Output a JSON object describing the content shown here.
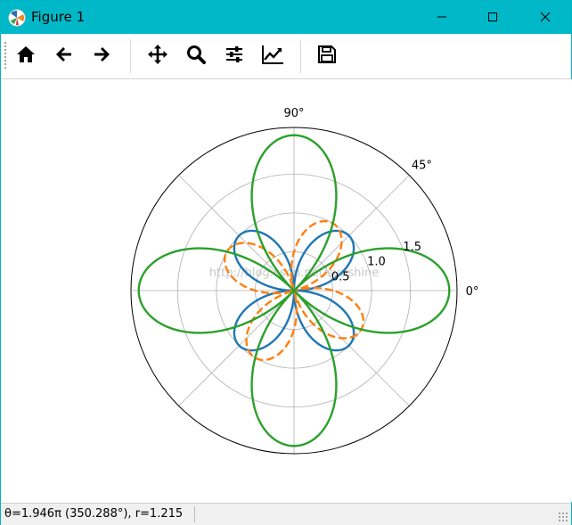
{
  "window": {
    "title": "Figure 1",
    "app_icon": "matplotlib-icon",
    "controls": [
      "minimize-icon",
      "maximize-icon",
      "close-icon"
    ]
  },
  "toolbar": {
    "buttons": [
      {
        "name": "home",
        "icon": "home-icon"
      },
      {
        "name": "back",
        "icon": "back-arrow-icon"
      },
      {
        "name": "forward",
        "icon": "forward-arrow-icon"
      },
      {
        "name": "pan",
        "icon": "move-icon"
      },
      {
        "name": "zoom",
        "icon": "zoom-icon"
      },
      {
        "name": "subplots",
        "icon": "sliders-icon"
      },
      {
        "name": "customize",
        "icon": "line-chart-icon"
      },
      {
        "name": "save",
        "icon": "save-icon"
      }
    ]
  },
  "watermark": "http://blog.csdn.net/sunshine",
  "status": {
    "coordinates": "θ=1.946π (350.288°), r=1.215"
  },
  "chart_data": {
    "type": "polar-line",
    "theta_ticks": [
      "0°",
      "45°",
      "90°"
    ],
    "r_ticks": [
      "0.5",
      "1.0",
      "1.5"
    ],
    "r_tick_values": [
      0.5,
      1.0,
      1.5
    ],
    "rlim": [
      0,
      2.1
    ],
    "grid": true,
    "series": [
      {
        "equation": "r = |sin(2θ)|",
        "style": "solid",
        "color": "#1f77b4",
        "amplitude": 1.0,
        "petals": 4,
        "phase_deg": 0
      },
      {
        "equation": "r = |sin(2θ−30°)|",
        "style": "dashed",
        "color": "#ff7f0e",
        "amplitude": 1.0,
        "petals": 4,
        "phase_deg": -30
      },
      {
        "equation": "r = 2|cos(2θ)|",
        "style": "solid",
        "color": "#2ca02c",
        "amplitude": 2.0,
        "petals": 4,
        "phase_deg": 0
      }
    ]
  }
}
